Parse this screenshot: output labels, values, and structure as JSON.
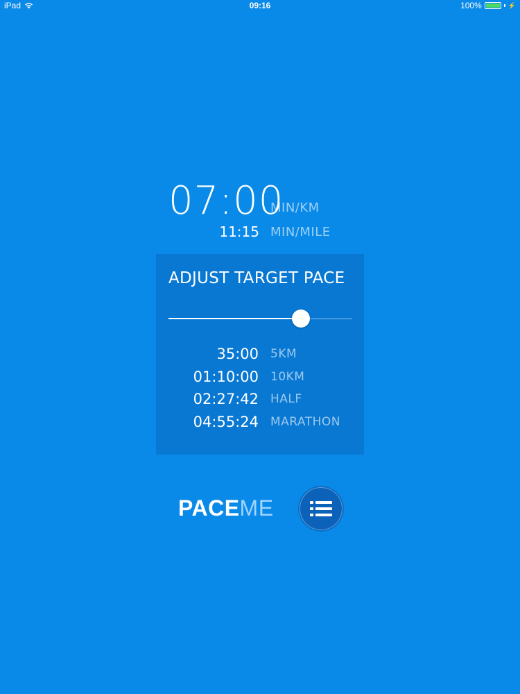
{
  "status_bar": {
    "device": "iPad",
    "time": "09:16",
    "battery": "100%",
    "battery_level": 1.0,
    "icons": [
      "wifi-icon",
      "battery-icon",
      "charge-icon"
    ]
  },
  "pace": {
    "main_value": "07:00",
    "main_unit": "MIN/KM",
    "secondary_value": "11:15",
    "secondary_unit": "MIN/MILE"
  },
  "panel": {
    "title": "ADJUST TARGET PACE",
    "slider_value": 0.72,
    "races": [
      {
        "time": "35:00",
        "label": "5KM"
      },
      {
        "time": "01:10:00",
        "label": "10KM"
      },
      {
        "time": "02:27:42",
        "label": "HALF"
      },
      {
        "time": "04:55:24",
        "label": "MARATHON"
      }
    ]
  },
  "brand": {
    "logo_part1": "PACE",
    "logo_part2": "ME"
  },
  "menu": {
    "icon": "list-icon"
  },
  "colors": {
    "background": "#0a8ae8",
    "panel": "#0878d3",
    "menu_button": "#0b62b8",
    "logo_accent": "#9fd4ff",
    "battery": "#4cd964"
  }
}
